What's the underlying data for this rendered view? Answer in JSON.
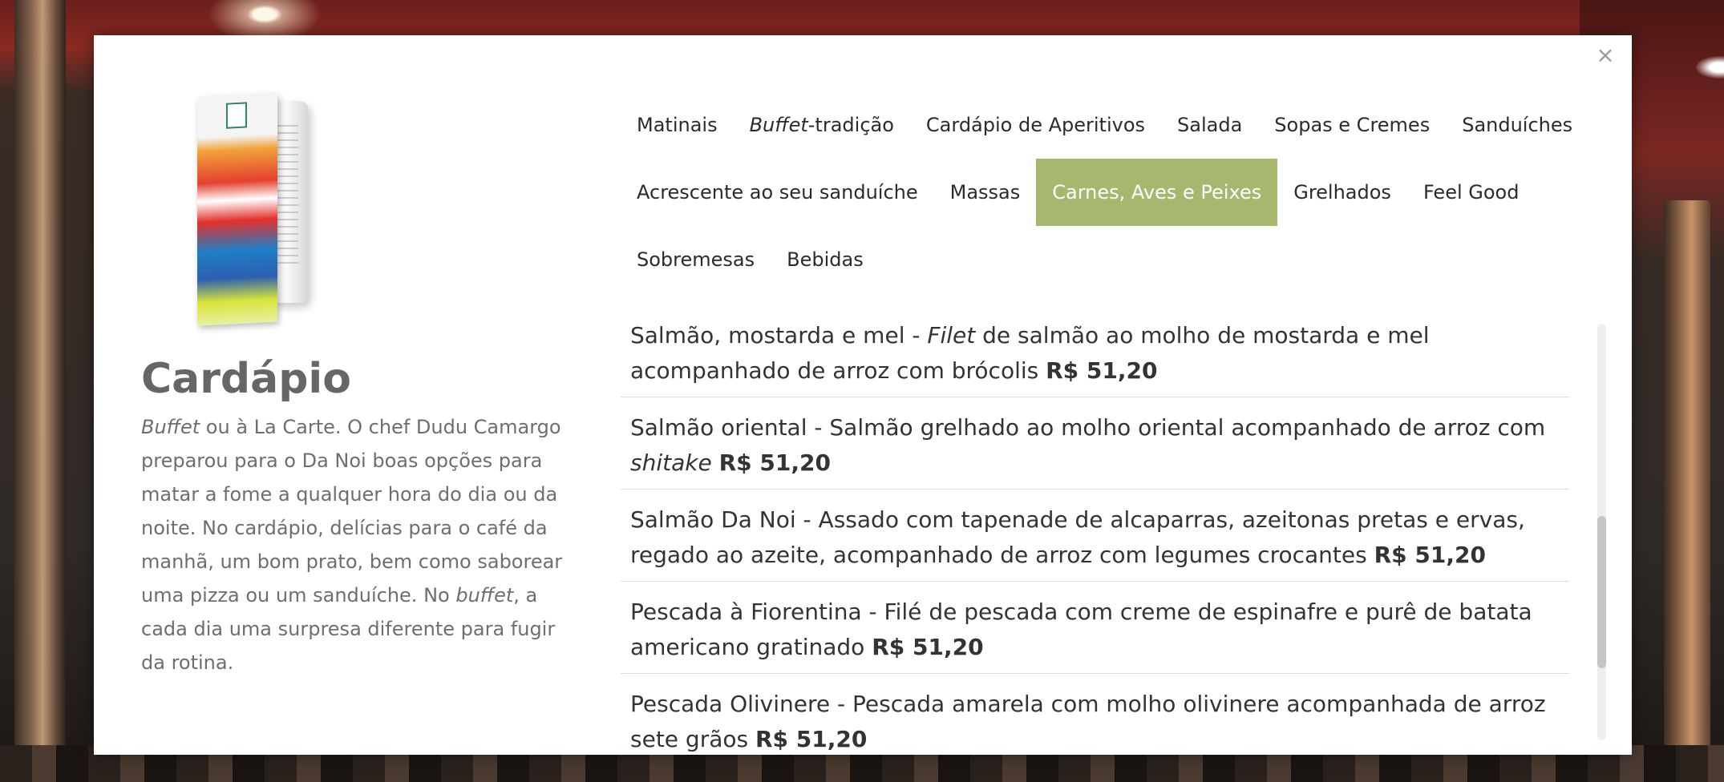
{
  "modal": {
    "close_label": "×",
    "title": "Cardápio",
    "description": {
      "p1_em": "Buffet",
      "p1_text": " ou à La Carte. O chef Dudu Camargo preparou para o Da Noi boas opções para matar a fome a qualquer hora do dia ou da noite. No cardápio, delícias para o café da manhã, um bom prato, bem como saborear uma pizza ou um sanduíche. No ",
      "p2_em": "buffet",
      "p2_text": ", a cada dia uma surpresa diferente para fugir da rotina."
    }
  },
  "tabs": [
    {
      "label": "Matinais"
    },
    {
      "label_em": "Buffet",
      "label_rest": "-tradição"
    },
    {
      "label": "Cardápio de Aperitivos"
    },
    {
      "label": "Salada"
    },
    {
      "label": "Sopas e Cremes"
    },
    {
      "label": "Sanduíches"
    },
    {
      "label": "Acrescente ao seu sanduíche"
    },
    {
      "label": "Massas"
    },
    {
      "label": "Carnes, Aves e Peixes",
      "active": true
    },
    {
      "label": "Grelhados"
    },
    {
      "label": "Feel Good"
    },
    {
      "label": "Sobremesas"
    },
    {
      "label": "Bebidas"
    }
  ],
  "items": [
    {
      "name": "Salmão, mostarda e mel - ",
      "desc_em": "Filet",
      "desc_after": " de salmão ao molho de mostarda e mel acompanhado de arroz com brócolis ",
      "price": "R$ 51,20"
    },
    {
      "name": "Salmão oriental - Salmão grelhado ao molho oriental acompanhado de arroz com ",
      "desc_em": "shitake",
      "desc_after": " ",
      "price": "R$ 51,20"
    },
    {
      "name": "Salmão Da Noi - Assado com tapenade de alcaparras, azeitonas pretas e ervas, regado ao azeite, acompanhado de arroz com legumes crocantes ",
      "price": "R$ 51,20"
    },
    {
      "name": "Pescada à Fiorentina - Filé de pescada com creme de espinafre e purê de batata americano gratinado ",
      "price": "R$ 51,20"
    },
    {
      "name": "Pescada Olivinere - Pescada amarela com molho olivinere acompanhada de arroz sete grãos ",
      "price": "R$ 51,20"
    }
  ],
  "colors": {
    "active_tab": "#a5b86e",
    "title": "#666666",
    "text": "#333333"
  }
}
